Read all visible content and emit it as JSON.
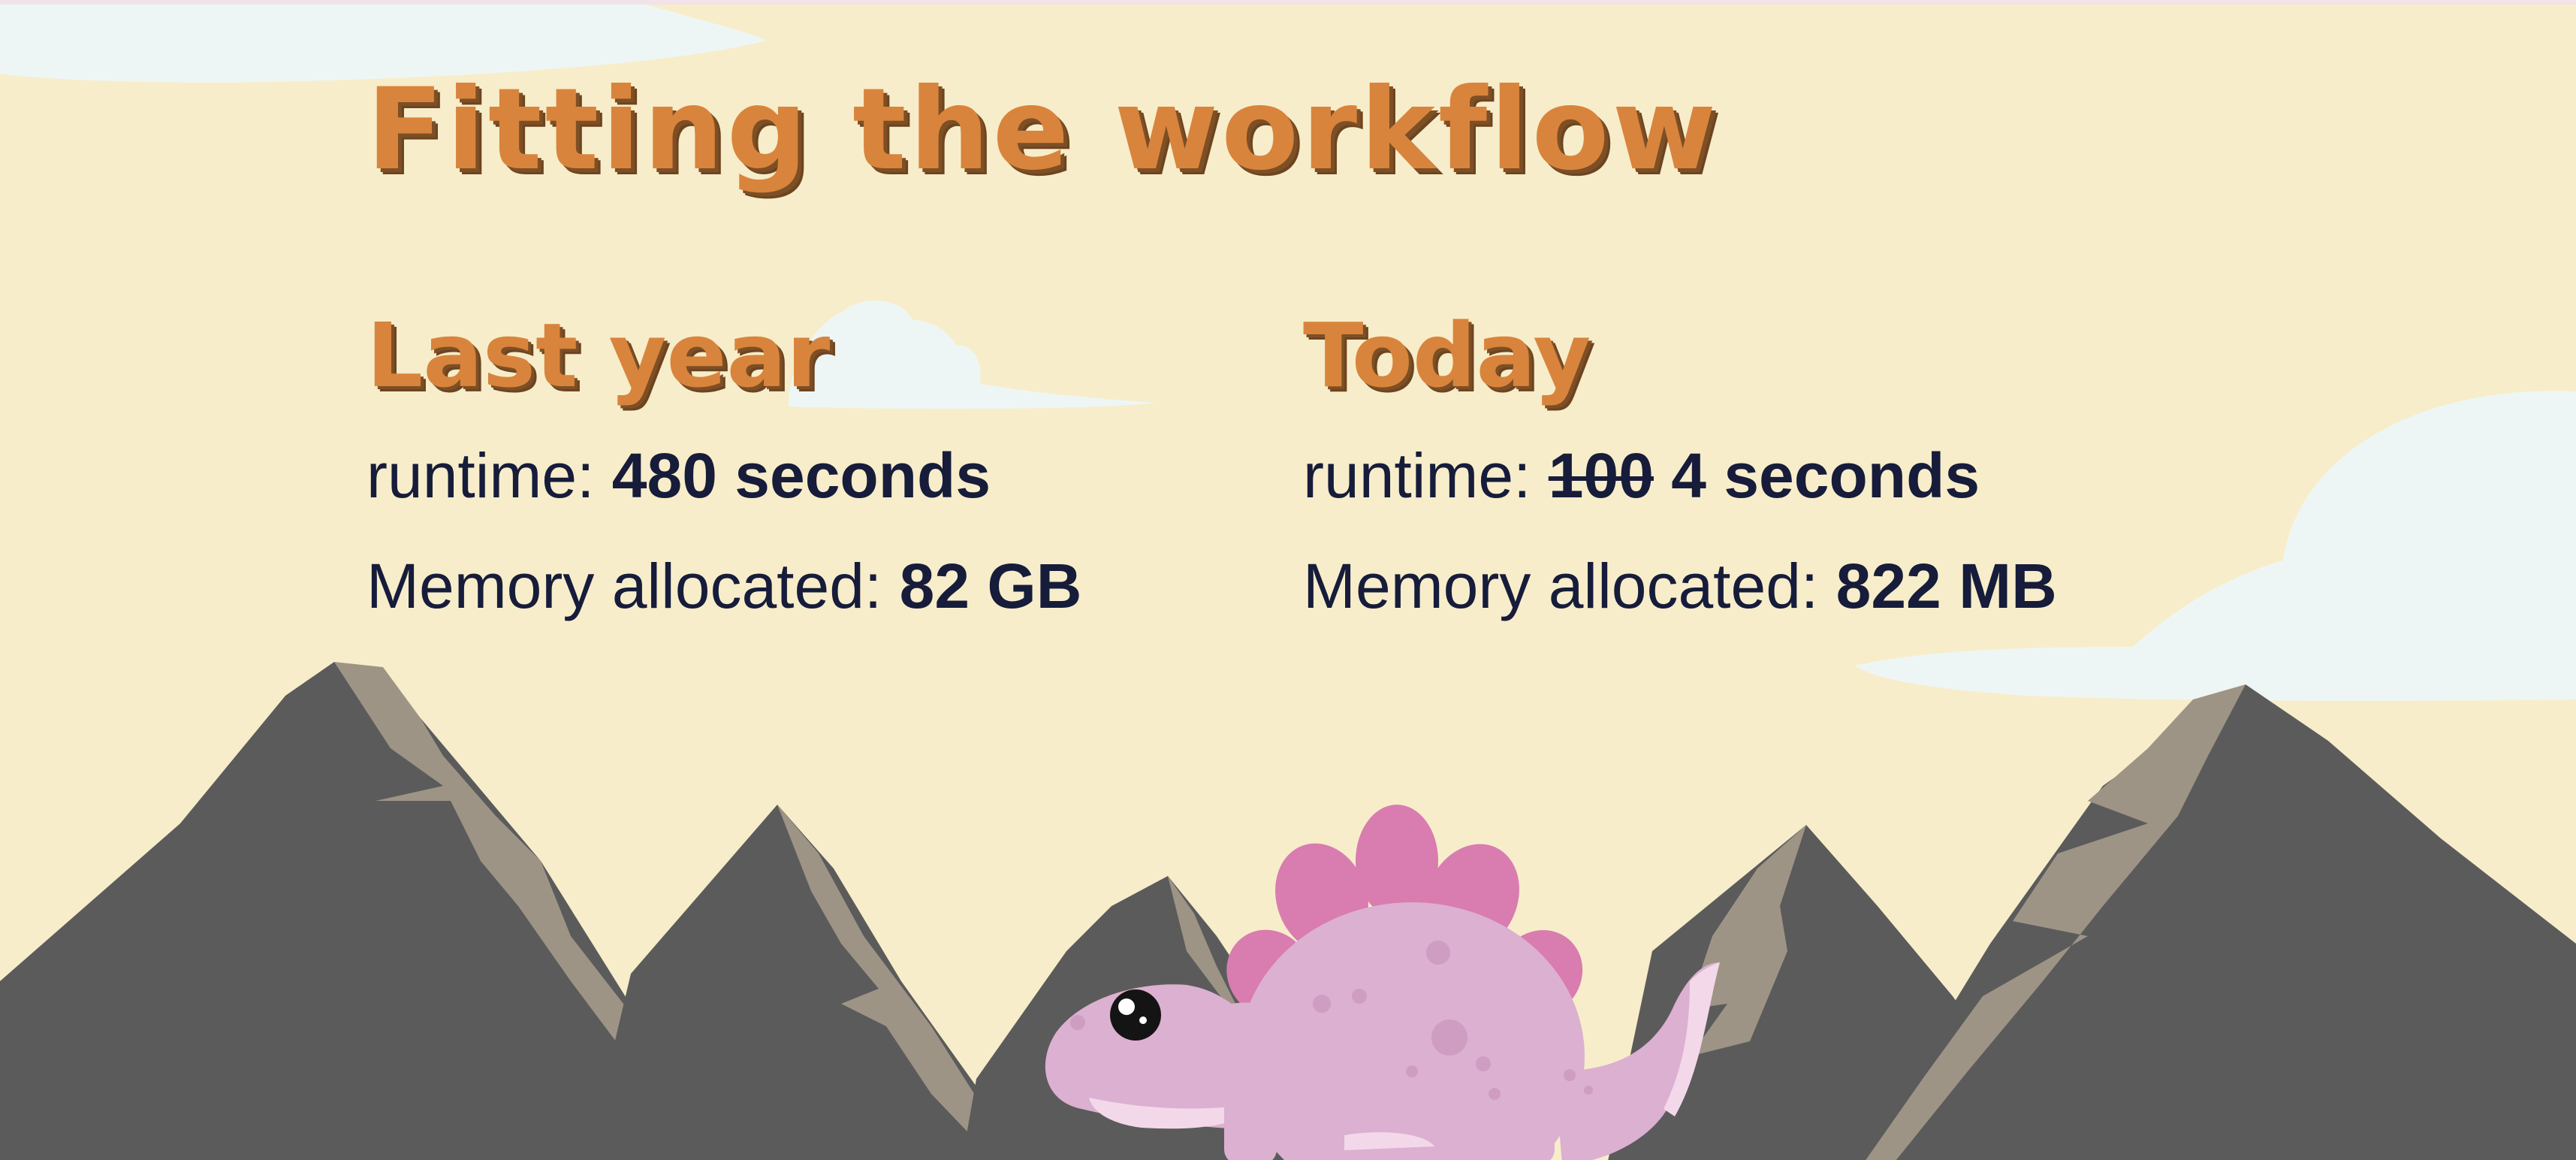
{
  "slide": {
    "title": "Fitting the workflow",
    "last_year": {
      "heading": "Last year",
      "runtime_label": "runtime:",
      "runtime_value": "480 seconds",
      "memory_label": "Memory allocated:",
      "memory_value": "82 GB"
    },
    "today": {
      "heading": "Today",
      "runtime_label": "runtime:",
      "runtime_old_value": "100",
      "runtime_value": "4 seconds",
      "memory_label": "Memory allocated:",
      "memory_value": "822 MB"
    }
  },
  "colors": {
    "background": "#f7edca",
    "heading": "#d9843c",
    "text": "#161c3a",
    "mountain": "#5b5b5b",
    "mountain_ridge": "#9e9486",
    "cloud": "#eef6f5",
    "dino_body": "#dcb0d0",
    "dino_plates": "#d97cb0"
  },
  "icons": [
    "cloud-icon",
    "mountain-icon",
    "stegosaurus-icon"
  ]
}
